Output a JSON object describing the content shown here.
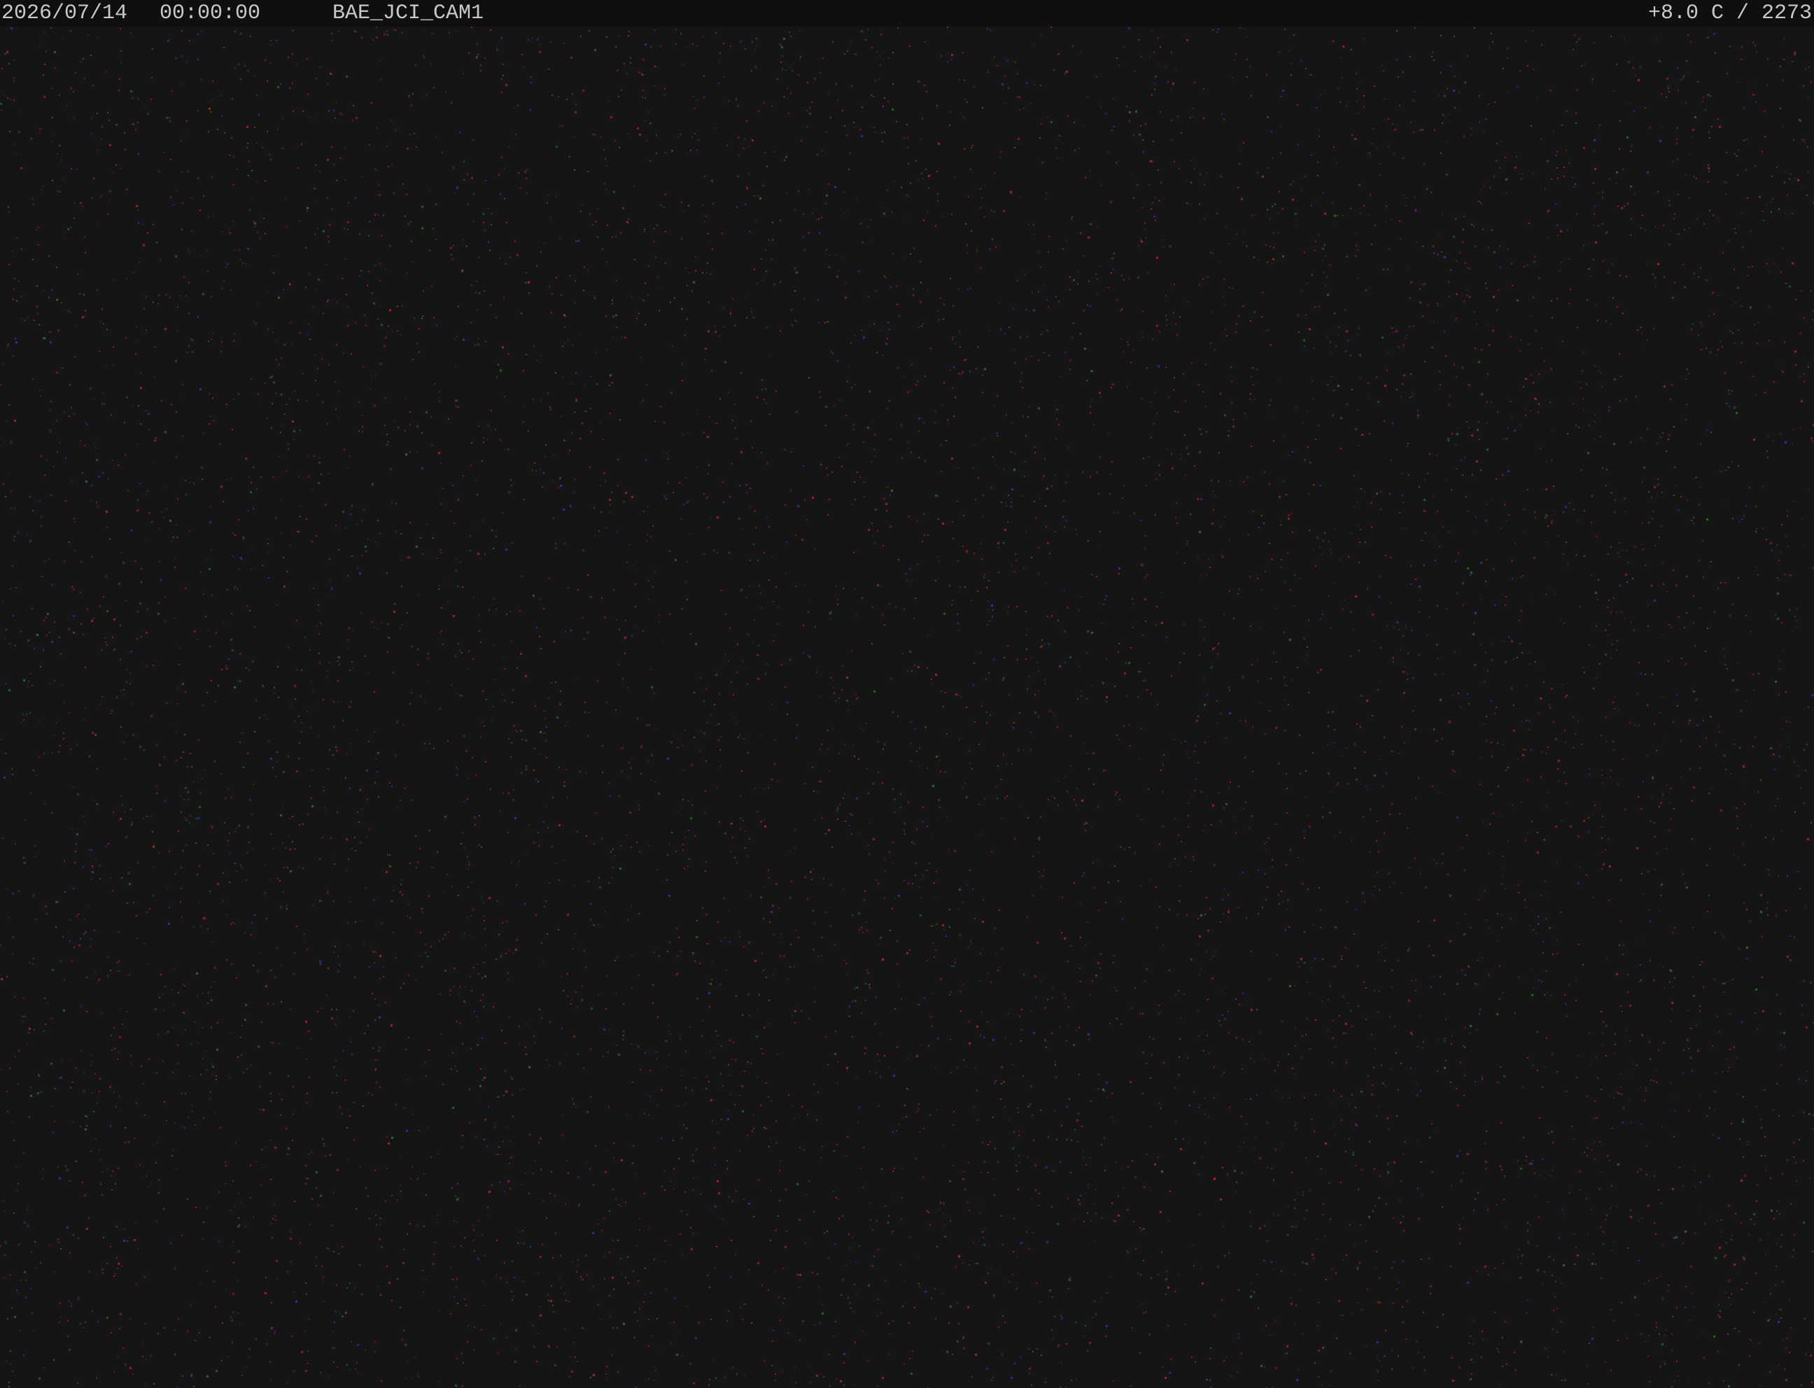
{
  "overlay": {
    "date": "2026/07/14",
    "time": "00:00:00",
    "camera_id": "BAE_JCI_CAM1",
    "readout": "+8.0 C / 2273"
  },
  "colors": {
    "background": "#151515",
    "topbar": "#0f0f0f",
    "overlay_text": "#c9c9c9",
    "noise_red": "#c8283a",
    "noise_green": "#3a7a3a",
    "noise_blue": "#3a3ac8"
  }
}
